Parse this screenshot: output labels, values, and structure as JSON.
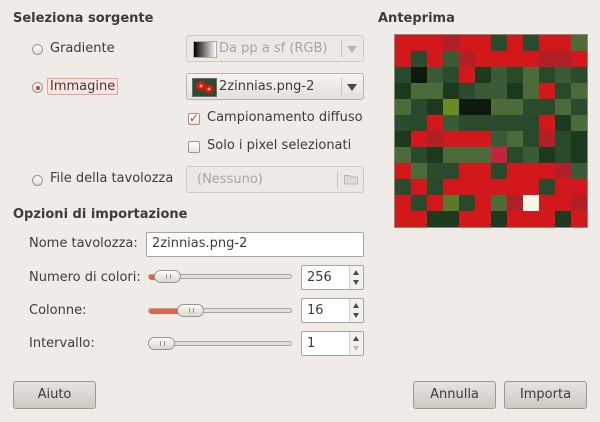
{
  "source": {
    "heading": "Seleziona sorgente",
    "gradient": {
      "label": "Gradiente",
      "selected": false,
      "combo_value": "Da pp a sf (RGB)",
      "enabled": false
    },
    "image": {
      "label": "Immagine",
      "selected": true,
      "combo_value": "2zinnias.png-2"
    },
    "sample_merged": {
      "label": "Campionamento diffuso",
      "checked": true
    },
    "selected_pixels": {
      "label": "Solo i pixel selezionati",
      "checked": false
    },
    "palette_file": {
      "label": "File della tavolozza",
      "selected": false,
      "value": "(Nessuno)",
      "enabled": false
    }
  },
  "preview": {
    "heading": "Anteprima",
    "colors": [
      "#d3181c",
      "#2c4a2c",
      "#3a5a38",
      "#264a2a",
      "#1e3a1e",
      "#4d6a3a",
      "#0f1a0f",
      "#6a8a24",
      "#c6243e",
      "#f6f6e6",
      "#5a7a2a",
      "#b02026"
    ]
  },
  "import": {
    "heading": "Opzioni di importazione",
    "palette_name": {
      "label": "Nome tavolozza:",
      "value": "2zinnias.png-2"
    },
    "num_colors": {
      "label": "Numero di colori:",
      "value": "256",
      "fraction": 0.05
    },
    "columns": {
      "label": "Colonne:",
      "value": "16",
      "fraction": 0.25
    },
    "interval": {
      "label": "Intervallo:",
      "value": "1",
      "fraction": 0.0
    }
  },
  "buttons": {
    "help": "Aiuto",
    "cancel": "Annulla",
    "import": "Importa"
  }
}
